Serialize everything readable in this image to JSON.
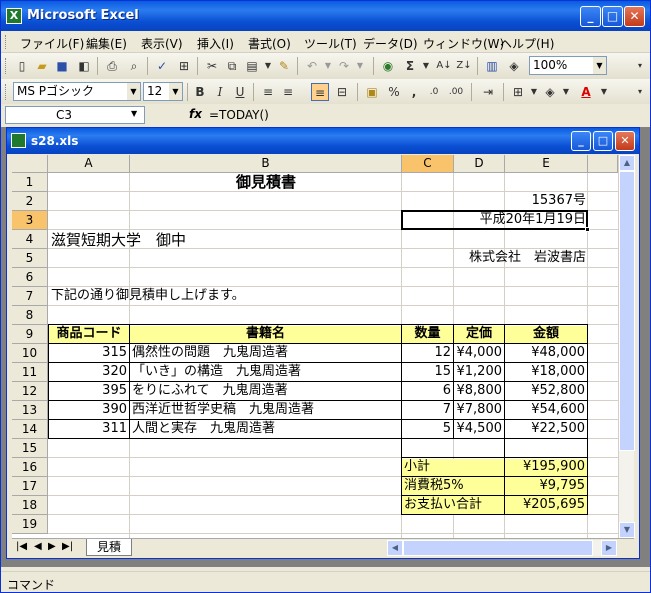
{
  "app_title": "Microsoft Excel",
  "window_buttons": {
    "minimize": "_",
    "restore": "□",
    "close": "✕"
  },
  "menu": [
    "ファイル(F)",
    "編集(E)",
    "表示(V)",
    "挿入(I)",
    "書式(O)",
    "ツール(T)",
    "データ(D)",
    "ウィンドウ(W)",
    "ヘルプ(H)"
  ],
  "toolbar": {
    "zoom": "100%",
    "font_name": "MS Pゴシック",
    "font_size": "12"
  },
  "formula_bar": {
    "name_box": "C3",
    "fx": "fx",
    "formula": "=TODAY()"
  },
  "workbook": {
    "title": "s28.xls"
  },
  "columns": [
    "A",
    "B",
    "C",
    "D",
    "E"
  ],
  "rows": [
    "1",
    "2",
    "3",
    "4",
    "5",
    "6",
    "7",
    "8",
    "9",
    "10",
    "11",
    "12",
    "13",
    "14",
    "15",
    "16",
    "17",
    "18",
    "19"
  ],
  "sheet": {
    "title": "御見積書",
    "number": "15367号",
    "date": "平成20年1月19日",
    "recipient": "滋賀短期大学　御中",
    "sender": "株式会社　岩波書店",
    "intro": "下記の通り御見積申し上げます。",
    "headers": {
      "code": "商品コード",
      "title": "書籍名",
      "qty": "数量",
      "price": "定価",
      "amount": "金額"
    },
    "items": [
      {
        "code": "315",
        "title": "偶然性の問題　九鬼周造著",
        "qty": "12",
        "price": "¥4,000",
        "amount": "¥48,000"
      },
      {
        "code": "320",
        "title": "「いき」の構造　九鬼周造著",
        "qty": "15",
        "price": "¥1,200",
        "amount": "¥18,000"
      },
      {
        "code": "395",
        "title": "をりにふれて　九鬼周造著",
        "qty": "6",
        "price": "¥8,800",
        "amount": "¥52,800"
      },
      {
        "code": "390",
        "title": "西洋近世哲学史稿　九鬼周造著",
        "qty": "7",
        "price": "¥7,800",
        "amount": "¥54,600"
      },
      {
        "code": "311",
        "title": "人間と実存　九鬼周造著",
        "qty": "5",
        "price": "¥4,500",
        "amount": "¥22,500"
      }
    ],
    "subtotal_label": "小計",
    "subtotal": "¥195,900",
    "tax_label": "消費税5%",
    "tax": "¥9,795",
    "total_label": "お支払い合計",
    "total": "¥205,695"
  },
  "sheet_tab": "見積",
  "status": "コマンド",
  "colors": {
    "selected_header": "#f8c36b",
    "highlight": "#ffff99",
    "titlebar": "#0a4fd3"
  }
}
